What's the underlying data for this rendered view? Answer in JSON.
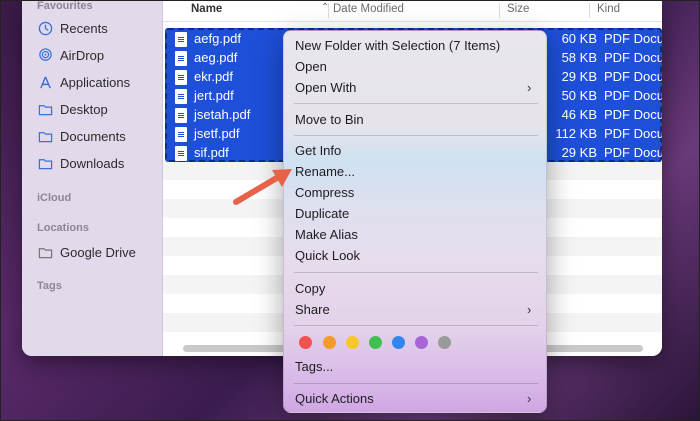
{
  "sidebar": {
    "favourites_label": "Favourites",
    "favourites": [
      {
        "label": "Recents",
        "icon": "clock-icon"
      },
      {
        "label": "AirDrop",
        "icon": "airdrop-icon"
      },
      {
        "label": "Applications",
        "icon": "applications-icon"
      },
      {
        "label": "Desktop",
        "icon": "folder-icon"
      },
      {
        "label": "Documents",
        "icon": "folder-icon"
      },
      {
        "label": "Downloads",
        "icon": "folder-icon"
      }
    ],
    "icloud_label": "iCloud",
    "locations_label": "Locations",
    "locations": [
      {
        "label": "Google Drive",
        "icon": "drive-icon"
      }
    ],
    "tags_label": "Tags"
  },
  "columns": {
    "name": "Name",
    "date_modified": "Date Modified",
    "size": "Size",
    "kind": "Kind"
  },
  "files": [
    {
      "name": "aefg.pdf",
      "size": "60 KB",
      "kind": "PDF Docum"
    },
    {
      "name": "aeg.pdf",
      "size": "58 KB",
      "kind": "PDF Docum"
    },
    {
      "name": "ekr.pdf",
      "size": "29 KB",
      "kind": "PDF Docum"
    },
    {
      "name": "jert.pdf",
      "size": "50 KB",
      "kind": "PDF Docum"
    },
    {
      "name": "jsetah.pdf",
      "size": "46 KB",
      "kind": "PDF Docum"
    },
    {
      "name": "jsetf.pdf",
      "size": "112 KB",
      "kind": "PDF Docum"
    },
    {
      "name": "sif.pdf",
      "size": "29 KB",
      "kind": "PDF Docum"
    }
  ],
  "context_menu": {
    "new_folder": "New Folder with Selection (7 Items)",
    "open": "Open",
    "open_with": "Open With",
    "move_to_bin": "Move to Bin",
    "get_info": "Get Info",
    "rename": "Rename...",
    "compress": "Compress",
    "duplicate": "Duplicate",
    "make_alias": "Make Alias",
    "quick_look": "Quick Look",
    "copy": "Copy",
    "share": "Share",
    "tags": "Tags...",
    "quick_actions": "Quick Actions",
    "tag_colors": [
      "#f0524f",
      "#f39a2b",
      "#f5c72a",
      "#3fc04f",
      "#2f86f0",
      "#a865d8",
      "#9a9a9a"
    ]
  },
  "colors": {
    "selection": "#1e4fd8",
    "arrow": "#e8624a"
  }
}
